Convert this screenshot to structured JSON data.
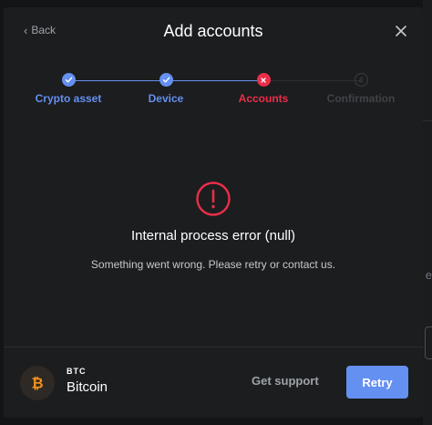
{
  "header": {
    "back_label": "Back",
    "title": "Add accounts"
  },
  "stepper": {
    "steps": [
      {
        "label": "Crypto asset",
        "state": "done"
      },
      {
        "label": "Device",
        "state": "done"
      },
      {
        "label": "Accounts",
        "state": "error"
      },
      {
        "label": "Confirmation",
        "state": "pending",
        "number": "4"
      }
    ]
  },
  "error": {
    "title": "Internal process error (null)",
    "message": "Something went wrong. Please retry or contact us."
  },
  "footer": {
    "ticker": "BTC",
    "coin_name": "Bitcoin",
    "support_label": "Get support",
    "retry_label": "Retry"
  },
  "backdrop": {
    "partial_char": "e"
  },
  "colors": {
    "accent": "#6490f1",
    "error": "#ea2e49",
    "bitcoin": "#f7931a"
  }
}
